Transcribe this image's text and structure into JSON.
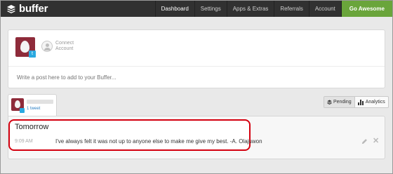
{
  "header": {
    "brand": "buffer",
    "nav": [
      {
        "label": "Dashboard",
        "active": true
      },
      {
        "label": "Settings",
        "active": false
      },
      {
        "label": "Apps & Extras",
        "active": false
      },
      {
        "label": "Referrals",
        "active": false
      },
      {
        "label": "Account",
        "active": false
      }
    ],
    "cta_label": "Go Awesome"
  },
  "composer": {
    "connect_label": "Connect Account",
    "placeholder": "Write a post here to add to your Buffer..."
  },
  "profile_tab": {
    "count_label": "1 tweet"
  },
  "view_toggle": {
    "pending_label": "Pending",
    "analytics_label": "Analytics"
  },
  "queue": {
    "day_label": "Tomorrow",
    "posts": [
      {
        "time": "9:09 AM",
        "text": "I've always felt it was not up to anyone else to make me give my best. -A. Olajuwon"
      }
    ]
  },
  "colors": {
    "navbar": "#313131",
    "cta": "#6aa53b",
    "highlight": "#d4000f",
    "twitter": "#2aa9e0",
    "avatar": "#8e2b3a"
  }
}
